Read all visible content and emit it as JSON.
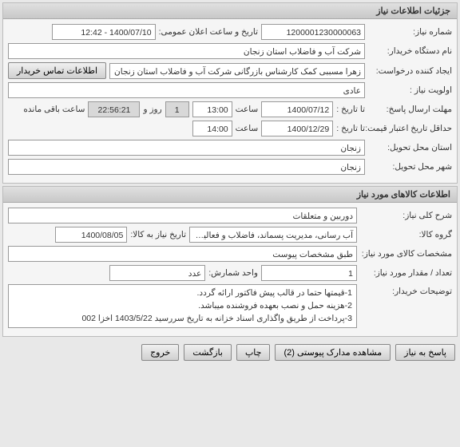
{
  "header1": {
    "title": "جزئیات اطلاعات نیاز"
  },
  "need": {
    "niaz_number_label": "شماره نیاز:",
    "niaz_number": "1200001230000063",
    "pub_date_label": "تاریخ و ساعت اعلان عمومی:",
    "pub_date": "1400/07/10 - 12:42",
    "buyer_name_label": "نام دستگاه خریدار:",
    "buyer_name": "شرکت آب و فاضلاب استان زنجان",
    "creator_label": "ایجاد کننده درخواست:",
    "creator": "زهرا مسببی کمک کارشناس بازرگانی شرکت آب و فاضلاب استان زنجان",
    "contact_btn": "اطلاعات تماس خریدار",
    "priority_label": "اولویت نیاز :",
    "priority": "عادی",
    "deadline_label": "مهلت ارسال پاسخ:",
    "to_date_label": "تا تاریخ :",
    "deadline_date": "1400/07/12",
    "saat_label": "ساعت",
    "deadline_time": "13:00",
    "remain_days": "1",
    "remain_days_label": "روز و",
    "remain_time": "22:56:21",
    "remain_time_label": "ساعت باقی مانده",
    "min_credit_label": "حداقل تاریخ اعتبار قیمت:",
    "credit_date": "1400/12/29",
    "credit_time": "14:00",
    "ostan_label": "استان محل تحویل:",
    "ostan": "زنجان",
    "shahr_label": "شهر محل تحویل:",
    "shahr": "زنجان"
  },
  "header2": {
    "title": "اطلاعات کالاهای مورد نیاز"
  },
  "goods": {
    "gen_desc_label": "شرح کلی نیاز:",
    "gen_desc": "دوربین و متعلقات",
    "group_label": "گروه کالا:",
    "group": "آب رسانی، مدیریت پسماند، فاضلاب و فعالیت های",
    "need_to_date_label": "تاریخ نیاز به کالا:",
    "need_to_date": "1400/08/05",
    "spec_label": "مشخصات کالای مورد نیاز:",
    "spec": "طبق مشخصات پیوست",
    "qty_label": "تعداد / مقدار مورد نیاز:",
    "qty": "1",
    "unit_label": "واحد شمارش:",
    "unit": "عدد",
    "buyer_notes_label": "توضیحات خریدار:",
    "buyer_notes_l1": "1-قیمتها حتما در قالب پیش فاکتور ارائه گردد.",
    "buyer_notes_l2": "2-هزینه حمل و نصب بعهده فروشنده میباشد.",
    "buyer_notes_l3": "3-پرداخت از طریق واگذاری اسناد خزانه به تاریخ سررسید 1403/5/22 اخزا 002"
  },
  "buttons": {
    "reply": "پاسخ به نیاز",
    "attachments": "مشاهده مدارک پیوستی (2)",
    "print": "چاپ",
    "back": "بازگشت",
    "exit": "خروج"
  }
}
